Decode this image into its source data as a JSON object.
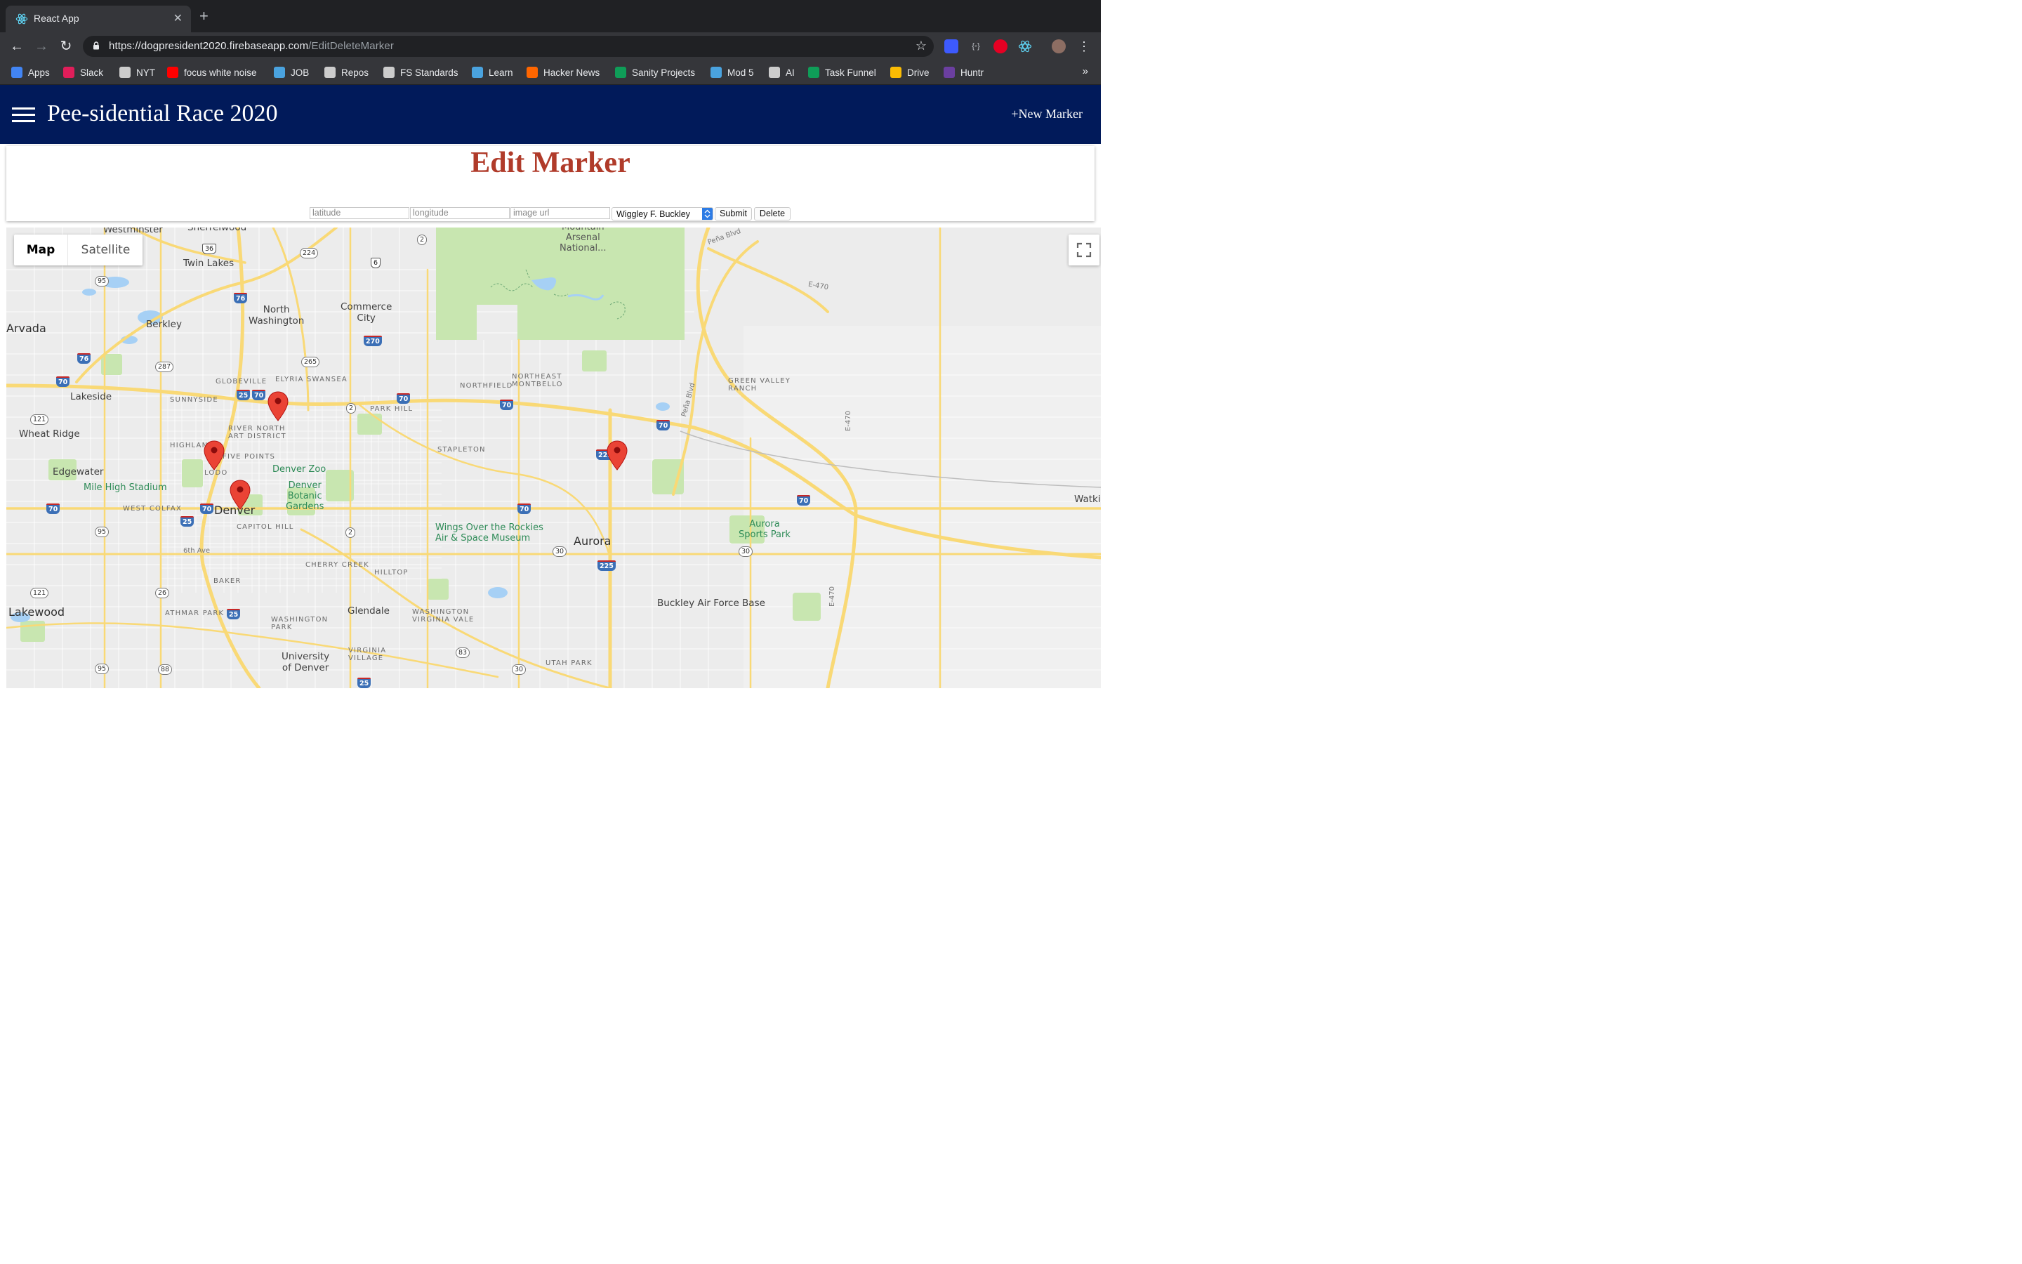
{
  "browser": {
    "tab_title": "React App",
    "url_host": "https://dogpresident2020.firebaseapp.com",
    "url_path": "/EditDeleteMarker",
    "bookmarks": [
      {
        "label": "Apps",
        "icon": "apps-grid-icon",
        "color": "#4285f4"
      },
      {
        "label": "Slack",
        "icon": "slack-icon",
        "color": "#e01e5a"
      },
      {
        "label": "NYT",
        "icon": "nyt-icon",
        "color": "#cccccc"
      },
      {
        "label": "focus white noise",
        "icon": "youtube-icon",
        "color": "#ff0000"
      },
      {
        "label": "JOB",
        "icon": "trello-bolt-icon",
        "color": "#4aa3df"
      },
      {
        "label": "Repos",
        "icon": "github-icon",
        "color": "#cccccc"
      },
      {
        "label": "FS Standards",
        "icon": "globe-icon",
        "color": "#cccccc"
      },
      {
        "label": "Learn",
        "icon": "trello-bolt-icon",
        "color": "#4aa3df"
      },
      {
        "label": "Hacker News",
        "icon": "hacker-news-icon",
        "color": "#ff6600"
      },
      {
        "label": "Sanity Projects",
        "icon": "sheets-icon",
        "color": "#0f9d58"
      },
      {
        "label": "Mod 5",
        "icon": "trello-bolt-icon",
        "color": "#4aa3df"
      },
      {
        "label": "AI",
        "icon": "globe-icon",
        "color": "#cccccc"
      },
      {
        "label": "Task Funnel",
        "icon": "sheets-icon",
        "color": "#0f9d58"
      },
      {
        "label": "Drive",
        "icon": "drive-icon",
        "color": "#fbbc04"
      },
      {
        "label": "Huntr",
        "icon": "huntr-icon",
        "color": "#6b3fa0"
      }
    ],
    "more": "»"
  },
  "app": {
    "title": "Pee-sidential Race 2020",
    "new_marker": "+New Marker",
    "header_color": "#011a5a"
  },
  "form": {
    "heading": "Edit Marker",
    "heading_color": "#b03b2a",
    "latitude_placeholder": "latitude",
    "longitude_placeholder": "longitude",
    "image_placeholder": "image url",
    "dog_selected": "Wiggley F. Buckley",
    "submit": "Submit",
    "delete": "Delete"
  },
  "map": {
    "map_type": "Map",
    "satellite_type": "Satellite",
    "labels": {
      "westminster": "Westminster",
      "sherrelwood": "Sherrelwood",
      "twin_lakes": "Twin Lakes",
      "arvada": "Arvada",
      "berkley": "Berkley",
      "north_washington": "North\nWashington",
      "commerce_city": "Commerce\nCity",
      "arsenal": "Mountain\nArsenal\nNational...",
      "globeville": "GLOBEVILLE",
      "elyria": "ELYRIA SWANSEA",
      "northeast_montbello": "NORTHEAST\nMONTBELLO",
      "northfield": "NORTHFIELD",
      "green_valley": "GREEN VALLEY\nRANCH",
      "lakeside": "Lakeside",
      "sunnyside": "SUNNYSIDE",
      "park_hill": "PARK HILL",
      "wheat_ridge": "Wheat Ridge",
      "rino": "RIVER NORTH\nART DISTRICT",
      "highland": "HIGHLAND",
      "five_points": "FIVE POINTS",
      "stapleton": "STAPLETON",
      "edgewater": "Edgewater",
      "denver_zoo": "Denver Zoo",
      "lodo": "LODO",
      "mile_high": "Mile High Stadium",
      "botanic": "Denver\nBotanic\nGardens",
      "west_colfax": "WEST COLFAX",
      "denver": "Denver",
      "capitol_hill": "CAPITOL HILL",
      "wings": "Wings Over the Rockies\nAir & Space Museum",
      "aurora": "Aurora",
      "aurora_sports": "Aurora\nSports Park",
      "watkins": "Watki",
      "sixth_ave": "6th Ave",
      "cherry_creek": "CHERRY CREEK",
      "hilltop": "HILLTOP",
      "baker": "BAKER",
      "lakewood": "Lakewood",
      "athmar": "ATHMAR PARK",
      "washington_park": "WASHINGTON\nPARK",
      "glendale": "Glendale",
      "washington_virginia": "WASHINGTON\nVIRGINIA VALE",
      "buckley": "Buckley Air Force Base",
      "virginia_village": "VIRGINIA\nVILLAGE",
      "university": "University\nof Denver",
      "utah_park": "UTAH PARK",
      "pena_blvd": "Peña Blvd",
      "pena_blvd2": "Peña Blvd",
      "e470": "E-470",
      "e470b": "E-470",
      "e470c": "E-470"
    },
    "shields": {
      "s36": "36",
      "s224": "224",
      "s2a": "2",
      "s6": "6",
      "s95a": "95",
      "s76a": "76",
      "s270": "270",
      "s76b": "76",
      "s287": "287",
      "s265": "265",
      "s70a": "70",
      "s25a": "25",
      "s70b": "70",
      "s70c": "70",
      "s2b": "2",
      "s70d": "70",
      "s70e": "70",
      "s121a": "121",
      "s225a": "225",
      "s70f": "70",
      "s70g": "70",
      "s25b": "25",
      "s70h": "70",
      "s95b": "95",
      "s2c": "2",
      "s30a": "30",
      "s225b": "225",
      "s30b": "30",
      "s26": "26",
      "s121b": "121",
      "s25c": "25",
      "s95c": "95",
      "s88": "88",
      "s83": "83",
      "s30c": "30",
      "s25d": "25",
      "s70i": "70"
    },
    "pin_color": "#ea4335"
  }
}
